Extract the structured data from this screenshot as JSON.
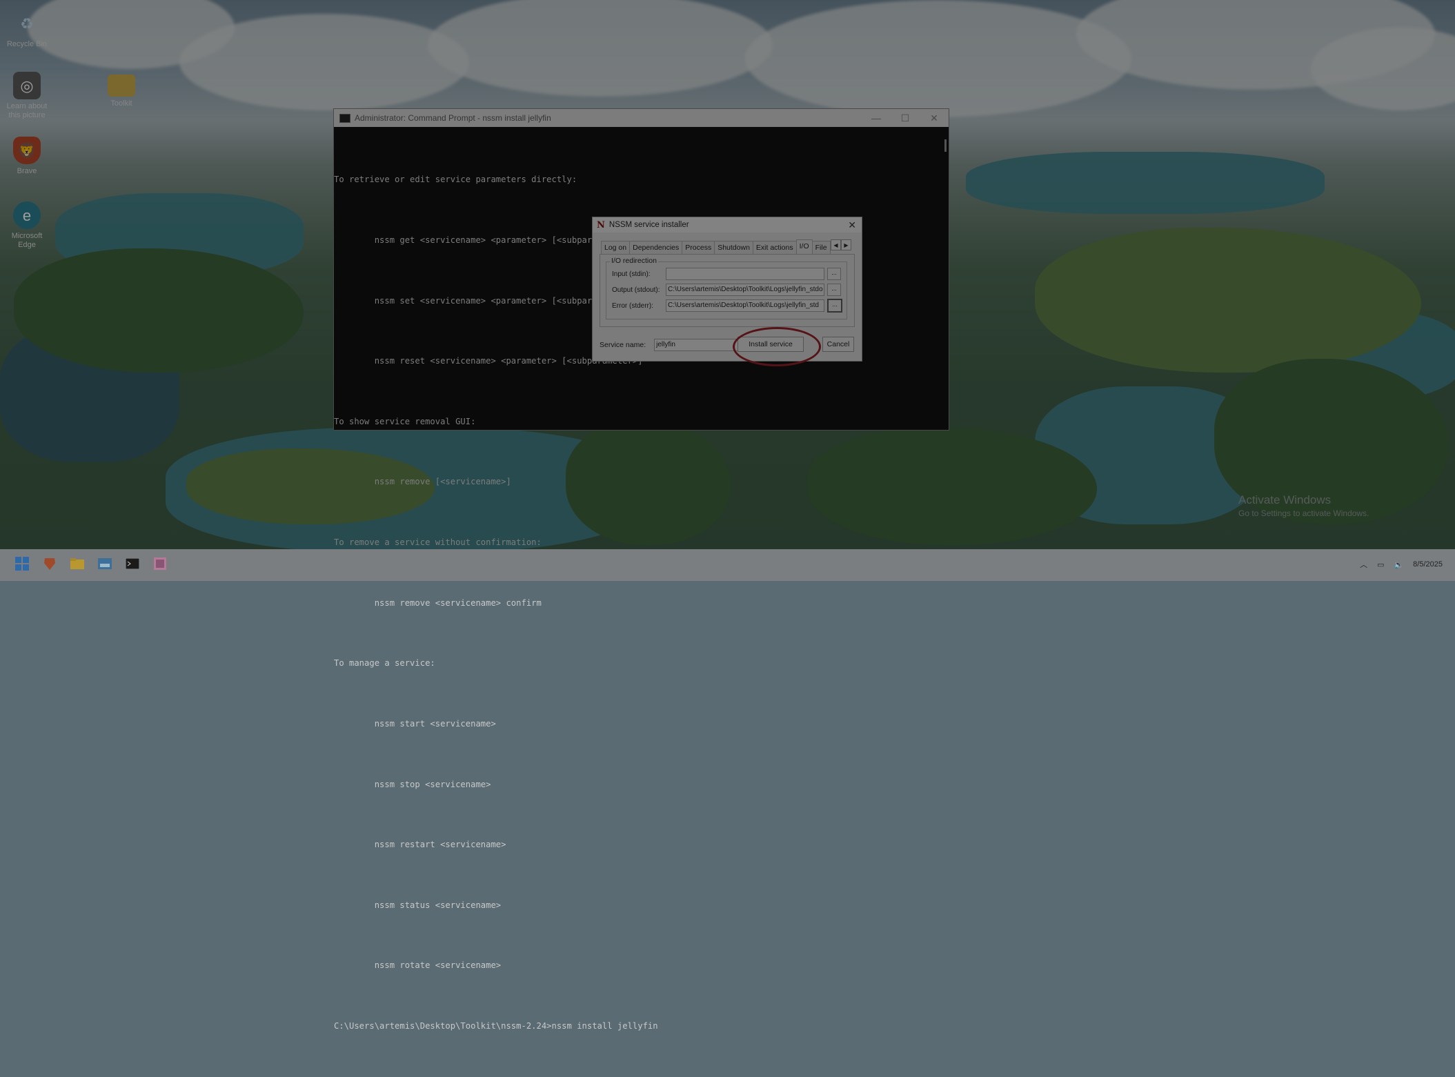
{
  "desktop": {
    "icons": [
      {
        "label": "Recycle Bin",
        "icon": "recycle-bin-icon"
      },
      {
        "label": "Learn about this picture",
        "icon": "camera-info-icon"
      },
      {
        "label": "Toolkit",
        "icon": "folder-icon"
      },
      {
        "label": "Brave",
        "icon": "brave-icon"
      },
      {
        "label": "Microsoft Edge",
        "icon": "edge-icon"
      }
    ],
    "watermark": {
      "line1": "Activate Windows",
      "line2": "Go to Settings to activate Windows."
    }
  },
  "cmd": {
    "title": "Administrator: Command Prompt - nssm  install jellyfin",
    "lines": [
      "To retrieve or edit service parameters directly:",
      "        nssm get <servicename> <parameter> [<subparameter>]",
      "        nssm set <servicename> <parameter> [<subparameter>] <value>",
      "        nssm reset <servicename> <parameter> [<subparameter>]",
      "To show service removal GUI:",
      "        nssm remove [<servicename>]",
      "To remove a service without confirmation:",
      "        nssm remove <servicename> confirm",
      "To manage a service:",
      "        nssm start <servicename>",
      "        nssm stop <servicename>",
      "        nssm restart <servicename>",
      "        nssm status <servicename>",
      "        nssm rotate <servicename>",
      "C:\\Users\\artemis\\Desktop\\Toolkit\\nssm-2.24>nssm install jellyfin"
    ]
  },
  "nssm": {
    "title": "NSSM service installer",
    "tabs": [
      "Log on",
      "Dependencies",
      "Process",
      "Shutdown",
      "Exit actions",
      "I/O",
      "File"
    ],
    "active_tab": "I/O",
    "group_label": "I/O redirection",
    "input_label": "Input (stdin):",
    "input_value": "",
    "output_label": "Output (stdout):",
    "output_value": "C:\\Users\\artemis\\Desktop\\Toolkit\\Logs\\jellyfin_stdo",
    "error_label": "Error (stderr):",
    "error_value": "C:\\Users\\artemis\\Desktop\\Toolkit\\Logs\\jellyfin_std",
    "browse_label": "...",
    "service_name_label": "Service name:",
    "service_name_value": "jellyfin",
    "install_button": "Install service",
    "cancel_button": "Cancel"
  },
  "taskbar": {
    "apps": [
      "start-icon",
      "brave-icon",
      "file-explorer-icon",
      "photos-icon",
      "terminal-icon",
      "nssm-icon"
    ],
    "date": "8/5/2025"
  }
}
